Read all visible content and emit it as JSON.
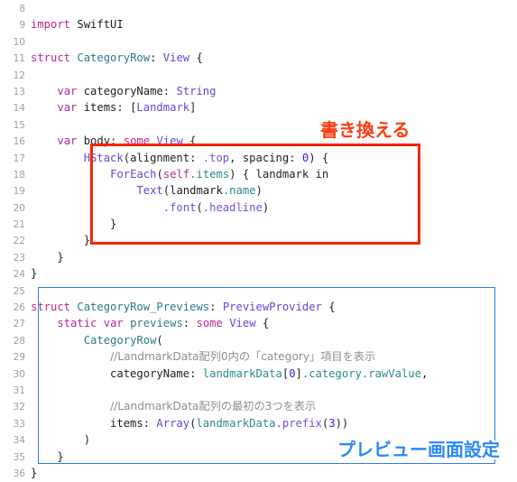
{
  "editor": {
    "language": "Swift",
    "background_color": "#ffffff",
    "gutter_color": "#9aa0a6",
    "lines": [
      {
        "n": "8",
        "text": ""
      },
      {
        "n": "9",
        "text": "import SwiftUI"
      },
      {
        "n": "10",
        "text": ""
      },
      {
        "n": "11",
        "text": "struct CategoryRow: View {"
      },
      {
        "n": "12",
        "text": ""
      },
      {
        "n": "13",
        "text": "    var categoryName: String"
      },
      {
        "n": "14",
        "text": "    var items: [Landmark]"
      },
      {
        "n": "15",
        "text": ""
      },
      {
        "n": "16",
        "text": "    var body: some View {"
      },
      {
        "n": "17",
        "text": "        HStack(alignment: .top, spacing: 0) {"
      },
      {
        "n": "18",
        "text": "            ForEach(self.items) { landmark in"
      },
      {
        "n": "19",
        "text": "                Text(landmark.name)"
      },
      {
        "n": "20",
        "text": "                    .font(.headline)"
      },
      {
        "n": "21",
        "text": "            }"
      },
      {
        "n": "22",
        "text": "        }"
      },
      {
        "n": "23",
        "text": "    }"
      },
      {
        "n": "24",
        "text": "}"
      },
      {
        "n": "25",
        "text": ""
      },
      {
        "n": "26",
        "text": "struct CategoryRow_Previews: PreviewProvider {"
      },
      {
        "n": "27",
        "text": "    static var previews: some View {"
      },
      {
        "n": "28",
        "text": "        CategoryRow("
      },
      {
        "n": "29",
        "text": "            //LandmarkData配列0内の「category」項目を表示"
      },
      {
        "n": "30",
        "text": "            categoryName: landmarkData[0].category.rawValue,"
      },
      {
        "n": "31",
        "text": ""
      },
      {
        "n": "32",
        "text": "            //LandmarkData配列の最初の3つを表示"
      },
      {
        "n": "33",
        "text": "            items: Array(landmarkData.prefix(3))"
      },
      {
        "n": "34",
        "text": "        )"
      },
      {
        "n": "35",
        "text": "    }"
      },
      {
        "n": "36",
        "text": "}"
      }
    ]
  },
  "annotations": {
    "red": {
      "label": "書き換える",
      "color": "#f93c11",
      "box_color": "#fb2200"
    },
    "blue": {
      "label": "プレビュー画面設定",
      "color": "#2b8bf2",
      "box_color": "#2f7fe8"
    }
  },
  "syntax_colors": {
    "keyword": "#b8288f",
    "declared_type": "#2d7a8c",
    "framework_type": "#5b4ad6",
    "property": "#2d8a8c",
    "enum_case": "#7a4fd6",
    "number": "#2b2bd6",
    "plain": "#1f1f1f",
    "comment": "#8b8f94"
  }
}
